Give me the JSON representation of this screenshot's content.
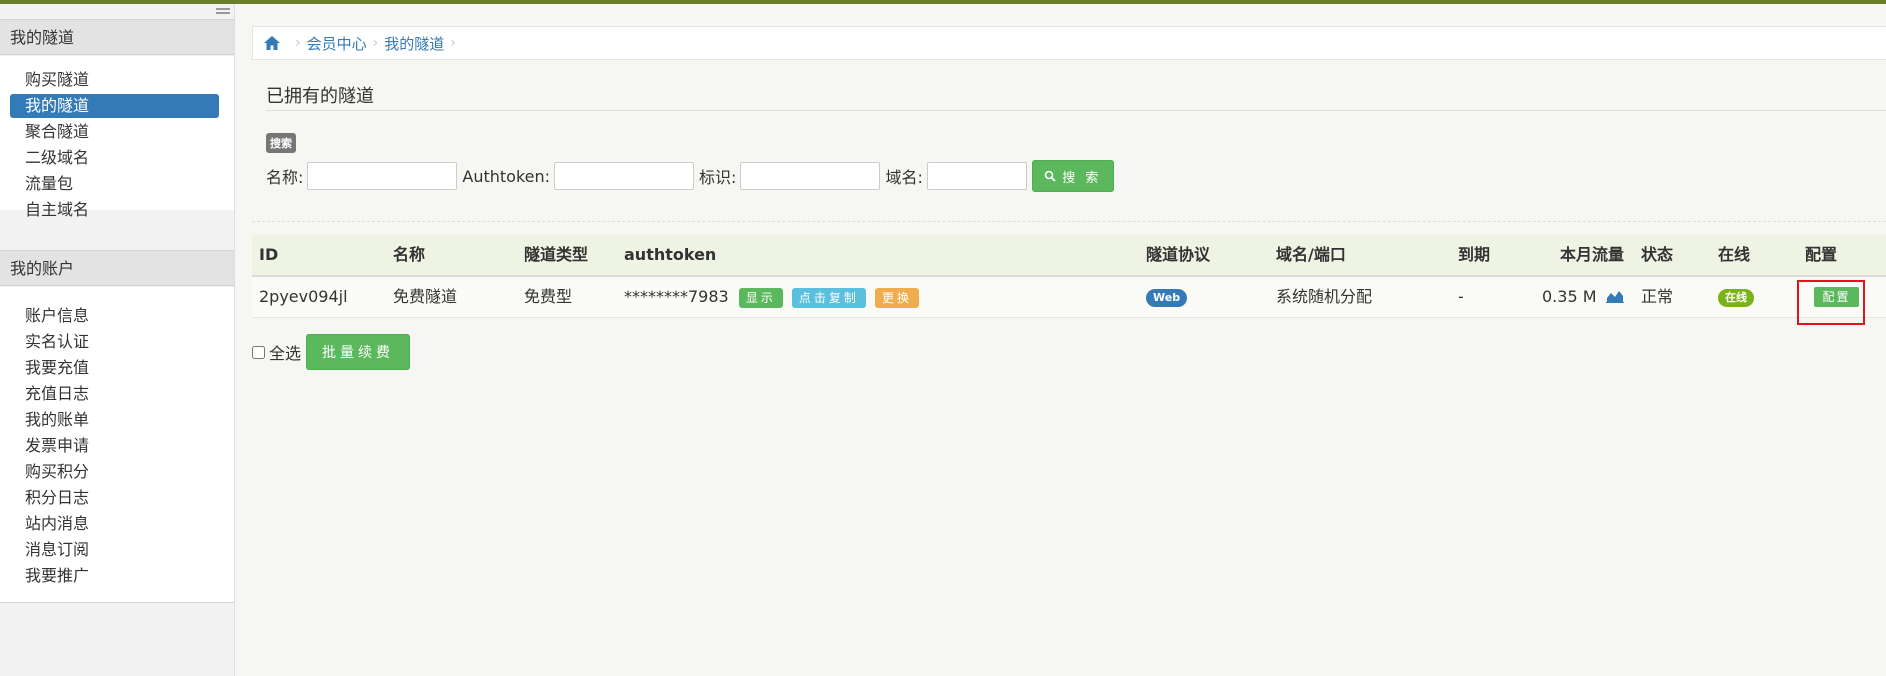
{
  "sidebar": {
    "sections": [
      {
        "title": "我的隧道",
        "items": [
          {
            "label": "购买隧道",
            "active": false
          },
          {
            "label": "我的隧道",
            "active": true
          },
          {
            "label": "聚合隧道",
            "active": false
          },
          {
            "label": "二级域名",
            "active": false
          },
          {
            "label": "流量包",
            "active": false
          },
          {
            "label": "自主域名",
            "active": false
          }
        ]
      },
      {
        "title": "我的账户",
        "items": [
          {
            "label": "账户信息"
          },
          {
            "label": "实名认证"
          },
          {
            "label": "我要充值"
          },
          {
            "label": "充值日志"
          },
          {
            "label": "我的账单"
          },
          {
            "label": "发票申请"
          },
          {
            "label": "购买积分"
          },
          {
            "label": "积分日志"
          },
          {
            "label": "站内消息"
          },
          {
            "label": "消息订阅"
          },
          {
            "label": "我要推广"
          }
        ]
      }
    ]
  },
  "breadcrumb": {
    "items": [
      "会员中心",
      "我的隧道"
    ]
  },
  "page": {
    "title": "已拥有的隧道"
  },
  "search": {
    "badge": "搜索",
    "name_label": "名称:",
    "authtoken_label": "Authtoken:",
    "tag_label": "标识:",
    "domain_label": "域名:",
    "name_value": "",
    "authtoken_value": "",
    "tag_value": "",
    "domain_value": "",
    "button_label": "搜 索"
  },
  "table": {
    "headers": {
      "id": "ID",
      "name": "名称",
      "type": "隧道类型",
      "authtoken": "authtoken",
      "protocol": "隧道协议",
      "domain": "域名/端口",
      "expire": "到期",
      "traffic": "本月流量",
      "status": "状态",
      "online": "在线",
      "config": "配置"
    },
    "rows": [
      {
        "id": "2pyev094jl",
        "name": "免费隧道",
        "type": "免费型",
        "authtoken": "********7983",
        "show_btn": "显示",
        "copy_btn": "点击复制",
        "change_btn": "更换",
        "protocol": "Web",
        "domain": "系统随机分配",
        "expire": "-",
        "traffic": "0.35 M",
        "status": "正常",
        "online": "在线",
        "config_btn": "配置"
      }
    ]
  },
  "bottom": {
    "select_all": "全选",
    "renew_btn": "批量续费"
  },
  "colors": {
    "accent": "#337ab7",
    "success": "#5cb85c",
    "info": "#5bc0de",
    "warning": "#f0ad4e",
    "highlight_border": "#e2131b",
    "top_bar": "#6b7f2a"
  }
}
